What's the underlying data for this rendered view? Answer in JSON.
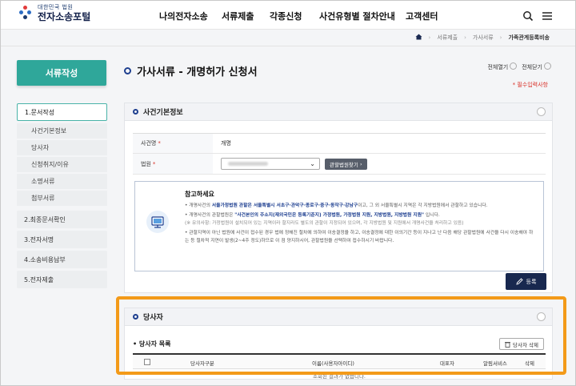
{
  "header": {
    "logo_small": "대한민국 법원",
    "logo_big": "전자소송포털",
    "nav": [
      "나의전자소송",
      "서류제출",
      "각종신청",
      "사건유형별 절차안내",
      "고객센터"
    ]
  },
  "breadcrumb": [
    "서류제출",
    "가사서류",
    "가족관계등록비송"
  ],
  "sidebar": {
    "title": "서류작성",
    "items": [
      {
        "label": "1.문서작성",
        "active": true,
        "subs": [
          "사건기본정보",
          "당사자",
          "신청취지/이유",
          "소명서류",
          "첨부서류"
        ]
      },
      {
        "label": "2.최종문서확인"
      },
      {
        "label": "3.전자서명"
      },
      {
        "label": "4.소송비용납부"
      },
      {
        "label": "5.전자제출"
      }
    ]
  },
  "main": {
    "title": "가사서류 - 개명허가 신청서",
    "expand_all": "전체열기",
    "collapse_all": "전체닫기",
    "required_note": "* 필수입력사항",
    "basic": {
      "heading": "사건기본정보",
      "case_name_label": "사건명",
      "case_name_value": "개명",
      "court_label": "법원",
      "court_find_btn": "관할법원찾기"
    },
    "notice": {
      "title": "참고하세요",
      "line1_a": "개명사건의 ",
      "line1_hl": "서울가정법원 관할은 서울특별시 서초구·관악구·종로구·중구·동작구·강남구",
      "line1_b": "이고, 그 외 서울특별시 지역은 각 지방법원에서 관할하고 있습니다.",
      "line2_a": "개명사건의 관할법원은 ",
      "line2_hl": "\"사건본인의 주소지(재외국민은 등록기준지) 가정법원, 가정법원 지원, 지방법원, 지방법원 지원\"",
      "line2_b": " 입니다.",
      "line2_note": "(※ 유의사항: 가정법원이 설치되어 있는 지역이라 할지라도 별도의 관할이 지정되어 있으며, 각 지방법원 및 지원에서 개명사건을 처리하고 있음)",
      "line3": "관할지역이 아닌 법원에 사건이 접수된 경우 법에 정해진 절차에 의하여 이송결정을 하고, 이송결정에 대한 이의기간 등이 지나고 난 다음 해당 관할법원에 사건을 다시 이송해야 하는 등 절차적 지연이 발생(2~4주 정도)하므로 이 점 양지하시어, 관할법원을 선택하여 접수하시기 바랍니다."
    },
    "register_btn": "등록",
    "party": {
      "heading": "당사자",
      "list_title": "당사자 목록",
      "delete_btn": "당사자 삭제",
      "columns": [
        "당사자구분",
        "이름(사용자아이디)",
        "대표자",
        "알림서비스",
        "삭제"
      ],
      "empty": "조회된 결과가 없습니다."
    }
  },
  "colors": {
    "sidebar_title": "#2fa79a",
    "highlight_box": "#f39a19",
    "register_btn": "#18284f"
  }
}
